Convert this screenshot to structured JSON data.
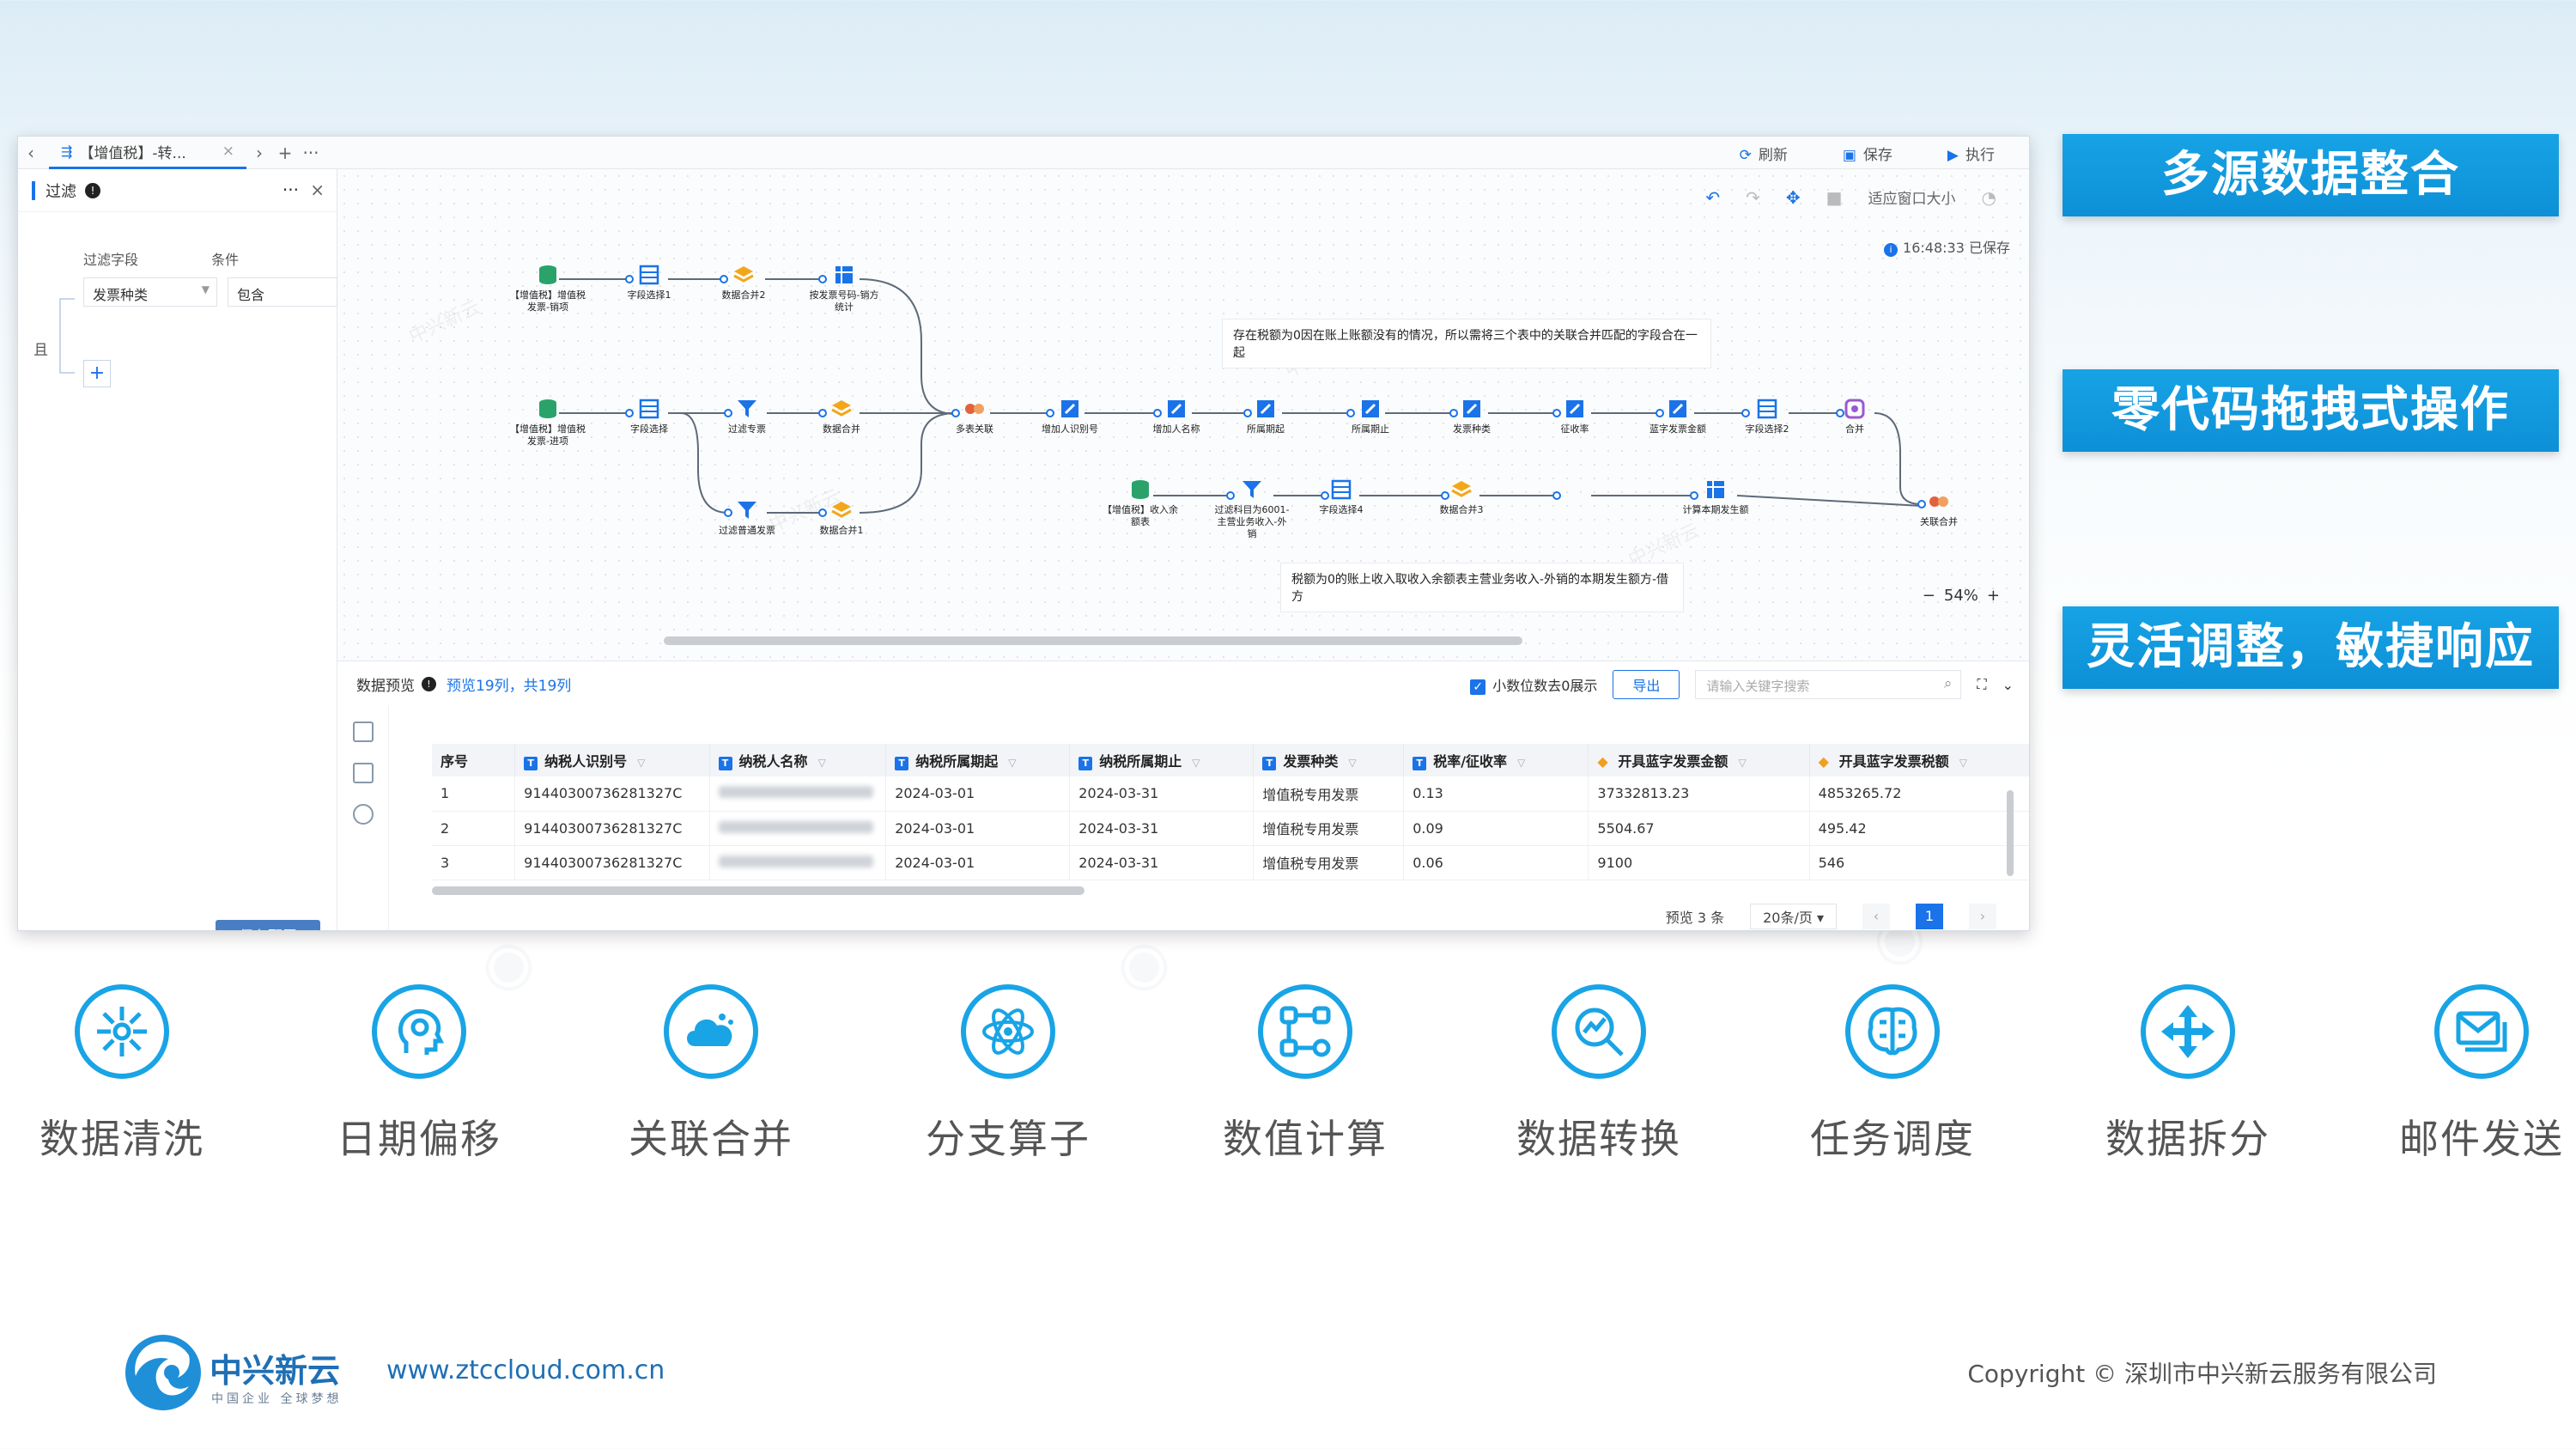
{
  "window": {
    "tab_label": "【增值税】-转...",
    "toolbar_refresh": "刷新",
    "toolbar_save": "保存",
    "toolbar_run": "执行"
  },
  "filter_panel": {
    "title": "过滤",
    "field_label": "过滤字段",
    "condition_label": "条件",
    "logic": "且",
    "field_value": "发票种类",
    "condition_value": "包含",
    "add_button": "+",
    "save_button": "保存配置"
  },
  "canvas": {
    "fit_window": "适应窗口大小",
    "saved_status": "16:48:33 已保存",
    "zoom": "54%",
    "note_1": "存在税额为0因在账上账额没有的情况，所以需将三个表中的关联合并匹配的字段合在一起",
    "note_2": "税额为0的账上收入取收入余额表主营业务收入-外销的本期发生额方-借方",
    "nodes": [
      {
        "label": "【增值税】增值税发票-销项",
        "icon": "db"
      },
      {
        "label": "字段选择1",
        "icon": "table"
      },
      {
        "label": "数据合并2",
        "icon": "stack"
      },
      {
        "label": "按发票号码-销方统计",
        "icon": "grid"
      },
      {
        "label": "【增值税】增值税发票-进项",
        "icon": "db"
      },
      {
        "label": "字段选择",
        "icon": "table"
      },
      {
        "label": "过滤专票",
        "icon": "filter"
      },
      {
        "label": "数据合并",
        "icon": "stack"
      },
      {
        "label": "过滤普通发票",
        "icon": "filter"
      },
      {
        "label": "数据合并1",
        "icon": "stack"
      },
      {
        "label": "多表关联",
        "icon": "join"
      },
      {
        "label": "增加人识别号",
        "icon": "edit"
      },
      {
        "label": "增加人名称",
        "icon": "edit"
      },
      {
        "label": "所属期起",
        "icon": "edit"
      },
      {
        "label": "所属期止",
        "icon": "edit"
      },
      {
        "label": "发票种类",
        "icon": "edit"
      },
      {
        "label": "征收率",
        "icon": "edit"
      },
      {
        "label": "蓝字发票金额",
        "icon": "edit"
      },
      {
        "label": "字段选择2",
        "icon": "table"
      },
      {
        "label": "合并",
        "icon": "merge"
      },
      {
        "label": "【增值税】收入余额表",
        "icon": "db"
      },
      {
        "label": "过滤科目为6001-主营业务收入-外销",
        "icon": "filter"
      },
      {
        "label": "字段选择4",
        "icon": "table"
      },
      {
        "label": "数据合并3",
        "icon": "stack"
      },
      {
        "label": "计算本期发生额",
        "icon": "grid"
      },
      {
        "label": "关联合并",
        "icon": "join"
      }
    ]
  },
  "preview": {
    "title": "数据预览",
    "summary": "预览19列，共19列",
    "decimal_label": "小数位数去0展示",
    "export_button": "导出",
    "search_placeholder": "请输入关键字搜索",
    "columns": [
      "序号",
      "纳税人识别号",
      "纳税人名称",
      "纳税所属期起",
      "纳税所属期止",
      "发票种类",
      "税率/征收率",
      "开具蓝字发票金额",
      "开具蓝字发票税额"
    ],
    "rows": [
      [
        "1",
        "9144030073628​1327C",
        "",
        "2024-03-01",
        "2024-03-31",
        "增值税专用发票",
        "0.13",
        "37332813.23",
        "4853265.72"
      ],
      [
        "2",
        "9144030073628​1327C",
        "",
        "2024-03-01",
        "2024-03-31",
        "增值税专用发票",
        "0.09",
        "5504.67",
        "495.42"
      ],
      [
        "3",
        "9144030073628​1327C",
        "",
        "2024-03-01",
        "2024-03-31",
        "增值税专用发票",
        "0.06",
        "9100",
        "546"
      ]
    ],
    "pager_total": "预览 3 条",
    "page_size": "20条/页",
    "current_page": "1"
  },
  "features": [
    "多源数据整合",
    "零代码拖拽式操作",
    "灵活调整，敏捷响应"
  ],
  "capabilities": [
    {
      "label": "数据清洗",
      "icon": "cleanse-icon"
    },
    {
      "label": "日期偏移",
      "icon": "head-icon"
    },
    {
      "label": "关联合并",
      "icon": "cloud-icon"
    },
    {
      "label": "分支算子",
      "icon": "atom-icon"
    },
    {
      "label": "数值计算",
      "icon": "nodes-icon"
    },
    {
      "label": "数据转换",
      "icon": "magnifier-icon"
    },
    {
      "label": "任务调度",
      "icon": "brain-icon"
    },
    {
      "label": "数据拆分",
      "icon": "arrows-icon"
    },
    {
      "label": "邮件发送",
      "icon": "mail-icon"
    }
  ],
  "footer": {
    "brand": "中兴新云",
    "slogan": "中国企业 全球梦想",
    "url": "www.ztccloud.com.cn",
    "copyright": "Copyright © 深圳市中兴新云服务有限公司"
  },
  "colors": {
    "accent": "#1a73e8",
    "feature_bg": "#17a3e6",
    "icon_ring": "#19a4e6"
  }
}
